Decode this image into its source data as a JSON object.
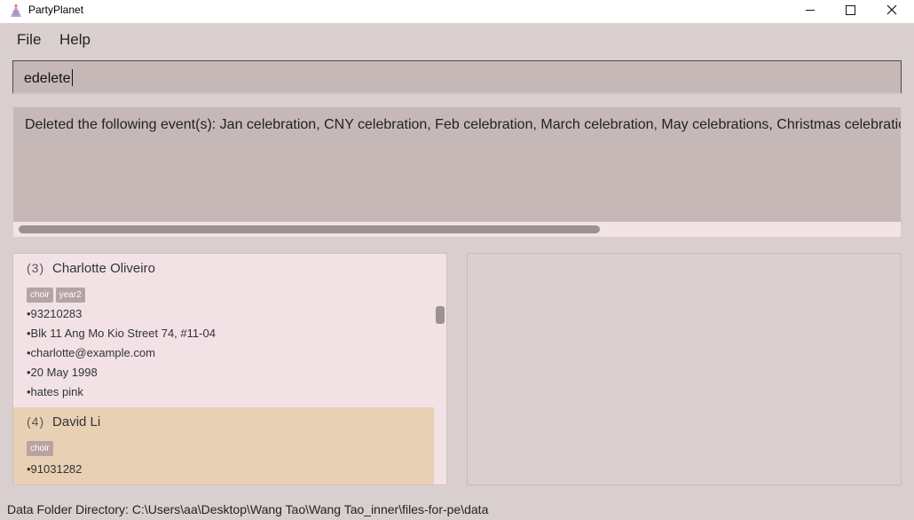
{
  "window": {
    "title": "PartyPlanet"
  },
  "menu": {
    "file": "File",
    "help": "Help"
  },
  "command": {
    "value": "edelete"
  },
  "result": {
    "text": "Deleted the following event(s): Jan celebration, CNY celebration, Feb celebration, March celebration, May celebrations, Christmas celebration"
  },
  "persons": [
    {
      "index": "3",
      "name": "Charlotte Oliveiro",
      "tags": [
        "choir",
        "year2"
      ],
      "phone": "•93210283",
      "address": "•Blk 11 Ang Mo Kio Street 74, #11-04",
      "email": "•charlotte@example.com",
      "birthday": "•20 May 1998",
      "remark": "•hates pink"
    },
    {
      "index": "4",
      "name": "David Li",
      "tags": [
        "choir"
      ],
      "phone": "•91031282"
    }
  ],
  "status": {
    "data_folder": "Data Folder Directory: C:\\Users\\aa\\Desktop\\Wang Tao\\Wang Tao_inner\\files-for-pe\\data"
  },
  "colors": {
    "background": "#dacfcf",
    "selected_card": "#e8d0b5",
    "tag": "#b6a3a3"
  }
}
